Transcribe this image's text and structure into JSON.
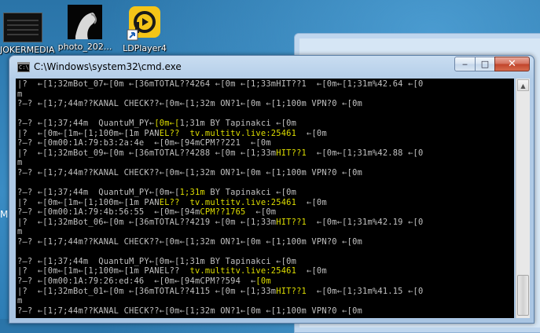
{
  "desktop": {
    "icons": [
      {
        "label": "JOKERMEDIA",
        "icon": "document-icon"
      },
      {
        "label": "photo_202...",
        "icon": "photo-icon"
      },
      {
        "label": "LDPlayer4",
        "icon": "ldplayer-icon"
      }
    ],
    "left_edge_letter": "M"
  },
  "window": {
    "title": "C:\\Windows\\system32\\cmd.exe",
    "minimize_glyph": "‒",
    "maximize_glyph": "□",
    "close_glyph": "✕",
    "colors": {
      "console_bg": "#000000",
      "text": "#c0c0c0",
      "highlight": "#dede00"
    }
  },
  "console": {
    "lines": [
      {
        "text": "|?  ←[1;32mBot_07←[0m ←[36mTOTAL??4264 ←[0m ←[1;33mHIT??1  ←[0m←[1;31m%42.64 ←[0"
      },
      {
        "text": "m"
      },
      {
        "text": "?—? ←[1;7;44m??KANAL CHECK??←[0m←[1;32m ON?1←[0m ←[1;100m VPN?0 ←[0m"
      },
      {
        "text": ""
      },
      {
        "pre": "?—? ←[1;37;44m  QuantuM_PY←",
        "hl": "[0m←[",
        "post": "1;31m BY Tapinakci ←[0m"
      },
      {
        "pre": "|?  ←[0m←[1m←[1;100m←[1m PAN",
        "hl": "EL??  tv.multitv.live:25461",
        "post": "  ←[0m"
      },
      {
        "text": "?—? ←[0m00:1A:79:b3:2a:4e  ←[0m←[94mCPM??221  ←[0m"
      },
      {
        "pre": "|?  ←[1;32mBot_09←[0m ←[36mTOTAL??4288 ←[0m ←[1;33m",
        "hl": "HIT??1",
        "post": "  ←[0m←[1;31m%42.88 ←[0"
      },
      {
        "text": "m"
      },
      {
        "text": "?—? ←[1;7;44m??KANAL CHECK??←[0m←[1;32m ON?1←[0m ←[1;100m VPN?0 ←[0m"
      },
      {
        "text": ""
      },
      {
        "pre": "?—? ←[1;37;44m  QuantuM_PY←[0m←[",
        "hl": "1;31m",
        "post": " BY Tapinakci ←[0m"
      },
      {
        "pre": "|?  ←[0m←[1m←[1;100m←[1m PAN",
        "hl": "EL??  tv.multitv.live:25461",
        "post": "  ←[0m"
      },
      {
        "pre": "?—? ←[0m00:1A:79:4b:56:55  ←[0m←[94m",
        "hl": "CPM??1765",
        "post": "  ←[0m"
      },
      {
        "pre": "|?  ←[1;32mBot_06←[0m ←[36mTOTAL??4219 ←[0m ←[1;33m",
        "hl": "HIT??1",
        "post": "  ←[0m←[1;31m%42.19 ←[0"
      },
      {
        "text": "m"
      },
      {
        "text": "?—? ←[1;7;44m??KANAL CHECK??←[0m←[1;32m ON?1←[0m ←[1;100m VPN?0 ←[0m"
      },
      {
        "text": ""
      },
      {
        "text": "?—? ←[1;37;44m  QuantuM_PY←[0m←[1;31m BY Tapinakci ←[0m"
      },
      {
        "pre": "|?  ←[0m←[1m←[1;100m←[1m PANEL??  ",
        "hl": "tv.multitv.live:25461",
        "post": "  ←[0m"
      },
      {
        "pre": "?—? ←[0m00:1A:79:26:ed:46  ←[0m←[94mCPM??594  ←",
        "hl": "[0m",
        "post": ""
      },
      {
        "pre": "|?  ←[1;32mBot_01←[0m ←[36mTOTAL??4115 ←[0m ←[1;33m",
        "hl": "HIT??1",
        "post": "  ←[0m←[1;31m%41.15 ←[0"
      },
      {
        "text": "m"
      },
      {
        "text": "?—? ←[1;7;44m??KANAL CHECK??←[0m←[1;32m ON?1←[0m ←[1;100m VPN?0 ←[0m"
      }
    ]
  }
}
